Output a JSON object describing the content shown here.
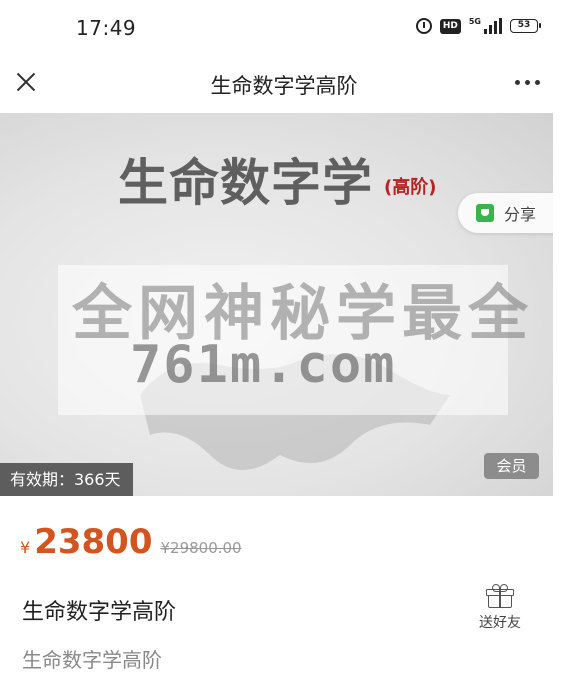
{
  "status_bar": {
    "time": "17:49",
    "hd": "HD",
    "network": "5G",
    "battery": "53"
  },
  "nav": {
    "title": "生命数字学高阶"
  },
  "banner": {
    "course_title": "生命数字学",
    "course_badge": "(高阶)",
    "share_label": "分享",
    "watermark_line1": "全网神秘学最全",
    "watermark_line2": "761m.com",
    "validity": "有效期：366天",
    "member_badge": "会员"
  },
  "product": {
    "currency": "¥",
    "price": "23800",
    "original_price": "¥29800.00",
    "name": "生命数字学高阶",
    "subtitle": "生命数字学高阶",
    "gift_label": "送好友"
  },
  "colors": {
    "price": "#d2541f",
    "badge_red": "#b52323",
    "share_green": "#3cb34a"
  }
}
